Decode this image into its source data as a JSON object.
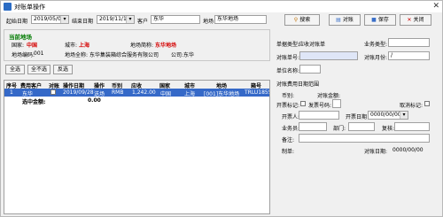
{
  "window": {
    "title": "对账单操作",
    "close_glyph": "✕"
  },
  "filter": {
    "start_label": "起始日期",
    "start_value": "2019/05/01",
    "end_label": "结束日期",
    "end_value": "2019/11/10",
    "customer_label": "客户",
    "customer_value": "东华",
    "site_label": "地场",
    "site_value": "东华地场"
  },
  "toolbar": {
    "search": "搜索",
    "reconcile": "对账",
    "save": "保存",
    "close": "关闭"
  },
  "site_panel": {
    "title": "当前地场",
    "country_label": "国家:",
    "country_value": "中国",
    "city_label": "城市:",
    "city_value": "上海",
    "short_label": "地场简称:",
    "short_value": "东华地场",
    "code_label": "地场编码:",
    "code_value": "001",
    "full_label": "地场全称:",
    "full_value": "东华集装箱综合服务有限公司",
    "company_label": "公司:",
    "company_value": "东华"
  },
  "selection": {
    "all": "全选",
    "none": "全不选",
    "invert": "反选"
  },
  "grid": {
    "headers": [
      "序号",
      "费用客户",
      "对账",
      "操作日期",
      "操作",
      "币别",
      "应收",
      "国家",
      "城市",
      "地场",
      "箱号"
    ],
    "row": [
      "1",
      "东华",
      "",
      "2019/09/28",
      "送场",
      "RMB",
      "1,242.00",
      "中国",
      "上海",
      "[001]东华地场",
      "TRLU18555"
    ],
    "summary_label": "选中金额:",
    "summary_value": "0.00"
  },
  "form": {
    "type_label": "单据类型:",
    "type_value": "应收对账单",
    "biz_label": "业务类型:",
    "biz_value": "",
    "no_label": "对账单号:",
    "no_value": "",
    "month_label": "对账月份:",
    "month_value": "/",
    "unit_label": "单位名称:",
    "unit_value": "",
    "range_label": "对账费用日期范围",
    "currency_label": "币别:",
    "amount_label": "对账金额:",
    "invoice_label": "开票标记:",
    "invoice_no_label": "发票号码:",
    "cancel_label": "取消标记:",
    "issuer_label": "开票人:",
    "issue_date_label": "开票日期",
    "issue_date_value": "0000/00/00",
    "clerk_label": "业务员:",
    "dept_label": "部门:",
    "reviewer_label": "复核:",
    "remark_label": "备注:",
    "maker_label": "制单:",
    "date_label": "对账日期:",
    "date_value": "0000/00/00"
  }
}
